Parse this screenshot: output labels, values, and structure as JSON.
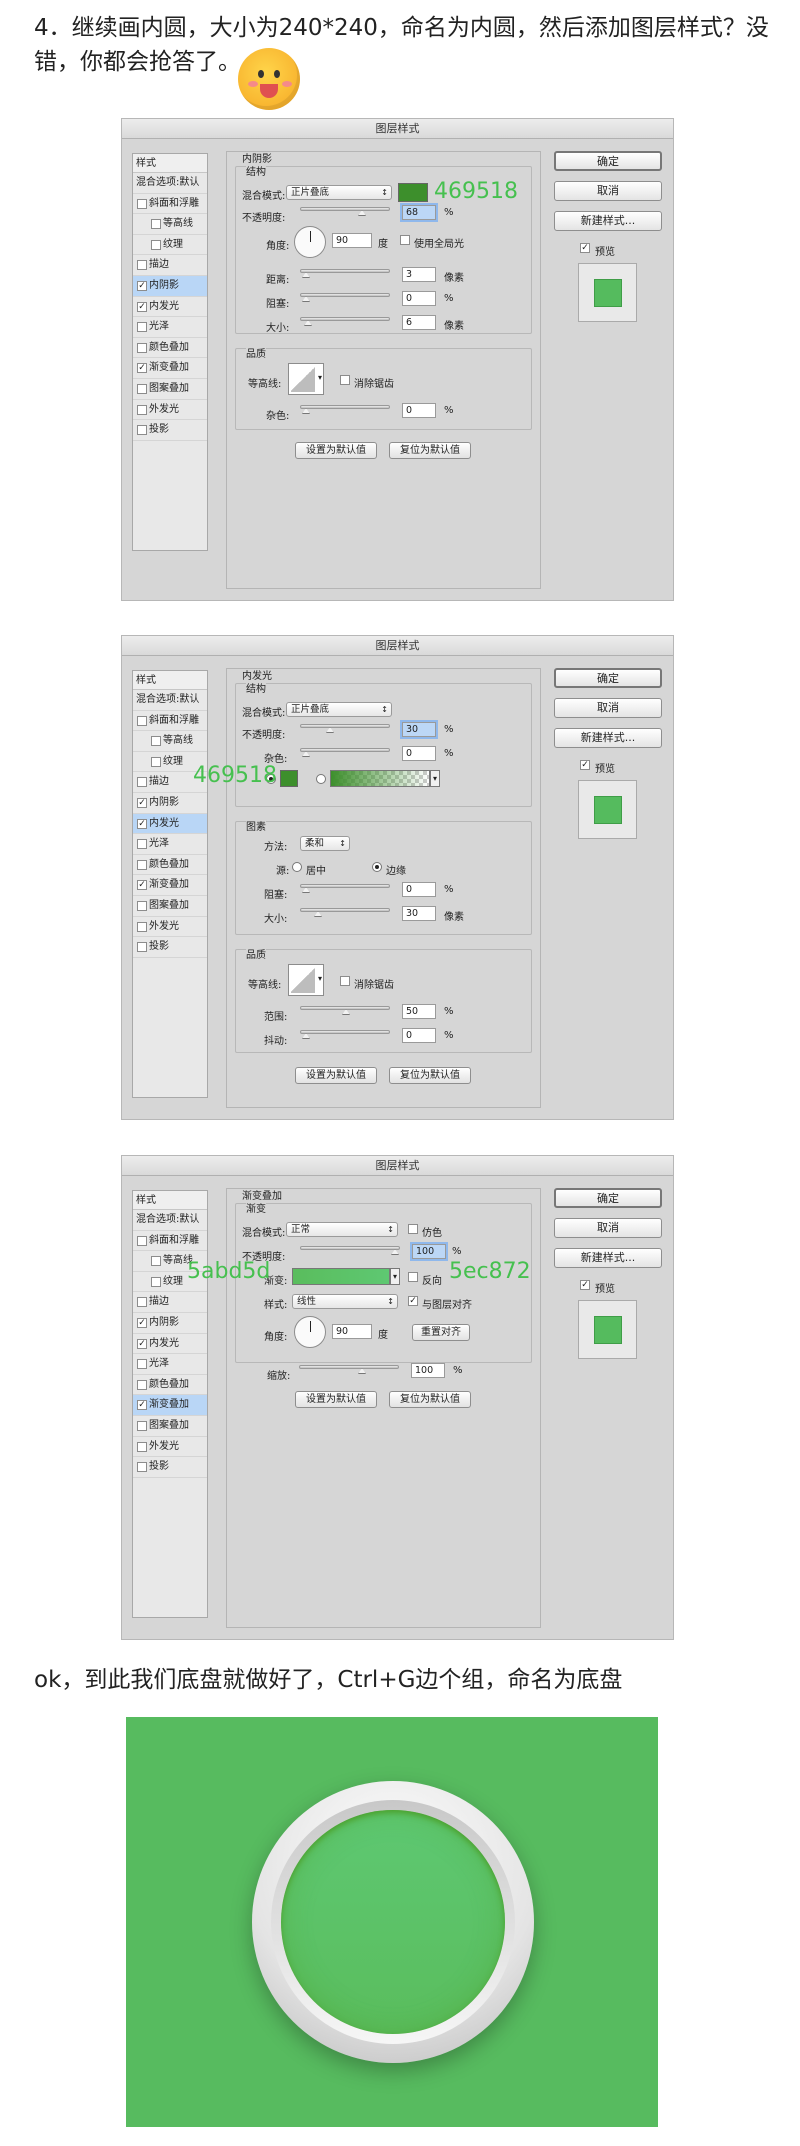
{
  "intro": {
    "line1": "4．继续画内圆，大小为240*240，命名为内圆，然后添加图层样式？没",
    "line2": "错，你都会抢答了。"
  },
  "outro": "ok，到此我们底盘就做好了，Ctrl+G边个组，命名为底盘",
  "colors": {
    "annotation": "#46c04f",
    "bg_green": "#57bb5f"
  },
  "common": {
    "title": "图层样式",
    "ok": "确定",
    "cancel": "取消",
    "new_style": "新建样式...",
    "preview": "预览",
    "set_default": "设置为默认值",
    "reset_default": "复位为默认值",
    "sidebar_header": "样式",
    "sidebar": [
      "混合选项:默认",
      "斜面和浮雕",
      "等高线",
      "纹理",
      "描边",
      "内阴影",
      "内发光",
      "光泽",
      "颜色叠加",
      "渐变叠加",
      "图案叠加",
      "外发光",
      "投影"
    ],
    "percent": "%",
    "pixel": "像素",
    "degree": "度"
  },
  "d1": {
    "section": "内阴影",
    "structure": "结构",
    "blend_label": "混合模式:",
    "blend": "正片叠底",
    "annotation": "469518",
    "opacity_label": "不透明度:",
    "opacity": "68",
    "angle_label": "角度:",
    "angle": "90",
    "global_light": "使用全局光",
    "distance_label": "距离:",
    "distance": "3",
    "choke_label": "阻塞:",
    "choke": "0",
    "size_label": "大小:",
    "size": "6",
    "quality": "品质",
    "contour_label": "等高线:",
    "anti_alias": "消除锯齿",
    "noise_label": "杂色:",
    "noise": "0",
    "checked": [
      "内阴影",
      "内发光",
      "渐变叠加"
    ],
    "selected": "内阴影"
  },
  "d2": {
    "section": "内发光",
    "structure": "结构",
    "blend_label": "混合模式:",
    "blend": "正片叠底",
    "opacity_label": "不透明度:",
    "opacity": "30",
    "noise_label": "杂色:",
    "noise": "0",
    "annotation": "469518",
    "elements": "图素",
    "method_label": "方法:",
    "method": "柔和",
    "source_label": "源:",
    "center": "居中",
    "edge": "边缘",
    "choke_label": "阻塞:",
    "choke": "0",
    "size_label": "大小:",
    "size": "30",
    "quality": "品质",
    "contour_label": "等高线:",
    "anti_alias": "消除锯齿",
    "range_label": "范围:",
    "range": "50",
    "jitter_label": "抖动:",
    "jitter": "0",
    "checked": [
      "内阴影",
      "内发光",
      "渐变叠加"
    ],
    "selected": "内发光"
  },
  "d3": {
    "section": "渐变叠加",
    "structure": "渐变",
    "blend_label": "混合模式:",
    "blend": "正常",
    "dither": "仿色",
    "opacity_label": "不透明度:",
    "opacity": "100",
    "gradient_label": "渐变:",
    "reverse": "反向",
    "ann_left": "5abd5d",
    "ann_right": "5ec872",
    "style_label": "样式:",
    "style": "线性",
    "align": "与图层对齐",
    "angle_label": "角度:",
    "angle": "90",
    "reset_align": "重置对齐",
    "scale_label": "缩放:",
    "scale": "100",
    "checked": [
      "内阴影",
      "内发光",
      "渐变叠加"
    ],
    "selected": "渐变叠加"
  }
}
